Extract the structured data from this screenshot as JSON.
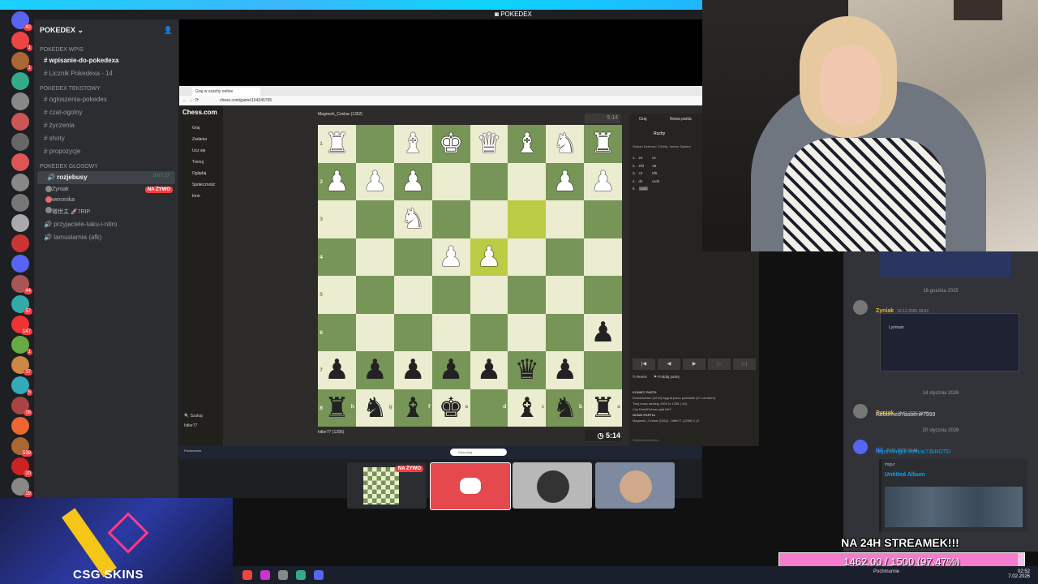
{
  "discord": {
    "window_title": "POKEDEX",
    "server_name": "POKEDEX",
    "categories": [
      {
        "label": "POKEDEX Wpis",
        "channels": [
          "wpisanie-do-pokedexa",
          "Licznik Pokedexa - 14"
        ]
      },
      {
        "label": "POKEDEX Tekstowy",
        "channels": [
          "ogloszenia-pokedex",
          "czat-ogolny",
          "życzenia",
          "shoty",
          "propozycje"
        ]
      },
      {
        "label": "POKEDEX GŁOSOWY"
      }
    ],
    "voice_channel": {
      "name": "rozjebusy",
      "time": "3:07:17"
    },
    "voice_users": [
      {
        "name": "Zyniak",
        "badge": "NA ŻYWO"
      },
      {
        "name": "weronika"
      },
      {
        "name": "微世主 🚀7RIP"
      }
    ],
    "other_voice": [
      "przyjaciele-taku-i-nitro",
      "lamusiarnia (afk)"
    ],
    "server_badges": [
      "42",
      "1",
      "1",
      "",
      "",
      "",
      "",
      "",
      "",
      "",
      "",
      "",
      "",
      "44",
      "57",
      "147",
      "1",
      "37",
      "5",
      "16",
      "",
      "539",
      "20",
      "19",
      "",
      "",
      "",
      ""
    ]
  },
  "browser": {
    "tab_label": "Graj w szachy online",
    "url": "chess.com/game/164345765",
    "site_name": "Chess.com",
    "nav_items": [
      "Graj",
      "Zadania",
      "Ucz się",
      "Trenuj",
      "Oglądaj",
      "Społeczność",
      "Inne"
    ],
    "nav_bottom": [
      "Szukaj",
      "hitler77"
    ],
    "top_player": "Magnesh_Czekar (1352)",
    "bottom_player": "hitler77 (1295)",
    "top_clock": "5:14",
    "bottom_clock": "5:14",
    "opening": "Sicilian Defense: O'Kelly, Venice System",
    "moves_tab": "Ruchy",
    "play_tab": "Graj",
    "new_game_tab": "Nowa partia",
    "moves": [
      [
        "1.",
        "e4",
        "c5"
      ],
      [
        "2.",
        "Sf3",
        "a6"
      ],
      [
        "3.",
        "c3",
        "Sf6"
      ],
      [
        "4.",
        "d4",
        "cxd4"
      ],
      [
        "5.",
        "cxd4",
        ""
      ]
    ],
    "chat_log": [
      "KONIEC PARTII",
      "DoshiDubaru (1216) wygrał przez poddanie (0:1 centrum)",
      "Twój nowy ranking 1301 to 1296 (-15).",
      "Czy DoshiDubaru grał fair?",
      "NOWA PARTIA",
      "Magnesh_Czekar (1352) - hitler77 (1296) 5 | 0"
    ],
    "remis_label": "Remis",
    "resign_label": "Poddaj partię",
    "chat_placeholder": "Wyślij wiadomość…"
  },
  "board": {
    "files": [
      "h",
      "g",
      "f",
      "e",
      "d",
      "c",
      "b",
      "a"
    ],
    "ranks": [
      "1",
      "2",
      "3",
      "4",
      "5",
      "6",
      "7",
      "8"
    ],
    "rows": [
      [
        "wR",
        "",
        "wB",
        "wK",
        "wQ",
        "wB",
        "wN",
        "wR"
      ],
      [
        "wP",
        "wP",
        "wP",
        "",
        "",
        "",
        "wP",
        "wP"
      ],
      [
        "",
        "",
        "wN",
        "",
        "",
        "",
        "",
        ""
      ],
      [
        "",
        "",
        "",
        "wP",
        "wP",
        "",
        "",
        ""
      ],
      [
        "",
        "",
        "",
        "",
        "",
        "",
        "",
        ""
      ],
      [
        "",
        "",
        "",
        "",
        "",
        "",
        "",
        "bP"
      ],
      [
        "bP",
        "bP",
        "bP",
        "bP",
        "bP",
        "bQ",
        "bP",
        ""
      ],
      [
        "bR",
        "bN",
        "bB",
        "bK",
        "",
        "bB",
        "bN",
        "bR"
      ]
    ],
    "highlights": [
      [
        2,
        5
      ],
      [
        3,
        4
      ]
    ]
  },
  "chat": {
    "messages": [
      {
        "date": "16 grudnia 2025",
        "author": "Zyniak",
        "time": "16.12.2025 18:52",
        "text": "",
        "color": "yellow",
        "attachment": "Lyrimain"
      },
      {
        "date": "14 stycznia 2026",
        "author": "Zyniak",
        "time": "14.01.2026 23:03",
        "text": "RebornedYasoen#7999",
        "color": "yellow"
      },
      {
        "date": "20 stycznia 2026",
        "author": "tkf",
        "time": "20.01.2026 03:48",
        "link": "https://imgur.com/a/73kROTD",
        "embed_site": "imgur",
        "embed_title": "Untitled Album",
        "color": "blue"
      }
    ]
  },
  "stream_tiles": [
    {
      "name": "chess-screen",
      "badge": "NA ŻYWO"
    },
    {
      "name": "discord-tile"
    },
    {
      "name": "car-tile"
    },
    {
      "name": "person-tile"
    }
  ],
  "logo_text": "CSG SKINS",
  "goal": {
    "title": "NA 24H STREAMEK!!!",
    "current": 1462.0,
    "target": 1500,
    "label": "1462.00 / 1500 (97.47%)",
    "fraction": 0.9747
  },
  "taskbar": {
    "weather": "Pochmurnie",
    "time": "02:52",
    "date": "7.02.2026",
    "search_placeholder": "Wyszukaj"
  },
  "colors": {
    "discord_bg": "#1e1f22",
    "board_light": "#ebecd0",
    "board_dark": "#779556",
    "highlight": "#bbcb44",
    "goal_fill": "#f37ccd",
    "live_red": "#f23f43"
  }
}
